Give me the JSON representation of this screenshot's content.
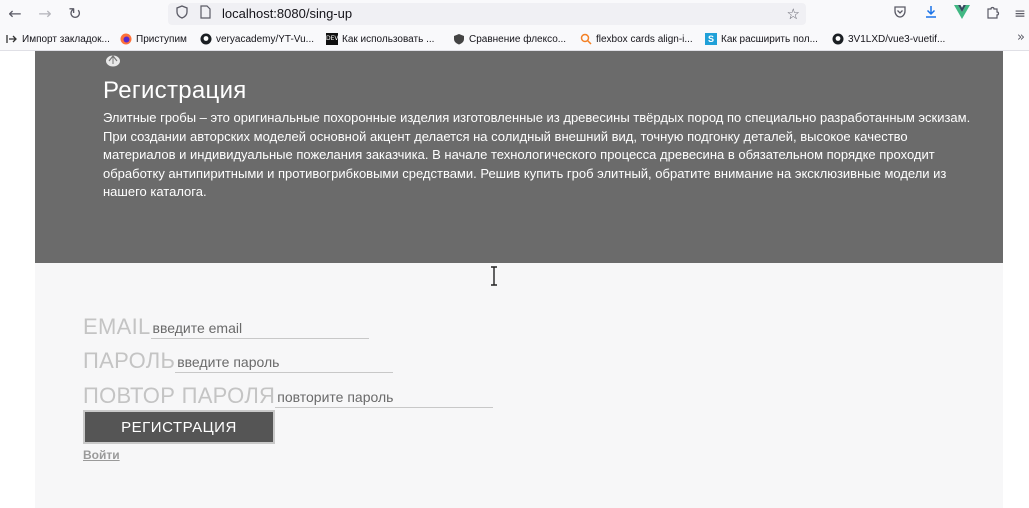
{
  "browser": {
    "url": "localhost:8080/sing-up",
    "icons": {
      "back": "arrow-left-icon",
      "forward": "arrow-right-icon",
      "reload": "reload-icon",
      "shield": "shield-icon",
      "page": "page-icon",
      "bookmark_star": "star-icon",
      "pocket": "pocket-icon",
      "download": "download-icon",
      "vue": "vue-devtools-icon",
      "extensions": "puzzle-icon",
      "menu": "hamburger-menu-icon"
    }
  },
  "bookmarks": [
    {
      "label": "Импорт закладок...",
      "icon": "import-icon"
    },
    {
      "label": "Приступим",
      "icon": "firefox-icon"
    },
    {
      "label": "veryacademy/YT-Vu...",
      "icon": "github-icon"
    },
    {
      "label": "Как использовать ...",
      "icon": "dev-icon"
    },
    {
      "label": "Сравнение флексо...",
      "icon": "shield-bookmark-icon"
    },
    {
      "label": "flexbox cards align-i...",
      "icon": "search-bookmark-icon"
    },
    {
      "label": "Как расширить пол...",
      "icon": "s-icon"
    },
    {
      "label": "3V1LXD/vue3-vuetif...",
      "icon": "github-icon"
    }
  ],
  "page": {
    "title": "Регистрация",
    "description": "Элитные гробы – это оригинальные похоронные изделия изготовленные из древесины твёрдых пород по специально разработанным эскизам. При создании авторских моделей основной акцент делается на солидный внешний вид, точную подгонку деталей, высокое качество материалов и индивидуальные пожелания заказчика. В начале технологического процесса древесина в обязательном порядке проходит обработку антипиритными и противогрибковыми средствами. Решив купить гроб элитный, обратите внимание на эксклюзивные модели из нашего каталога.",
    "form": {
      "email_label": "EMAIL",
      "email_placeholder": "введите email",
      "password_label": "ПАРОЛЬ",
      "password_placeholder": "введите пароль",
      "repeat_label": "ПОВТОР ПАРОЛЯ",
      "repeat_placeholder": "повторите пароль",
      "submit_label": "РЕГИСТРАЦИЯ",
      "login_link": "Войти"
    }
  },
  "colors": {
    "hero_bg": "#6b6b6b",
    "button_bg": "#555555",
    "label_color": "#c4c4c4"
  }
}
